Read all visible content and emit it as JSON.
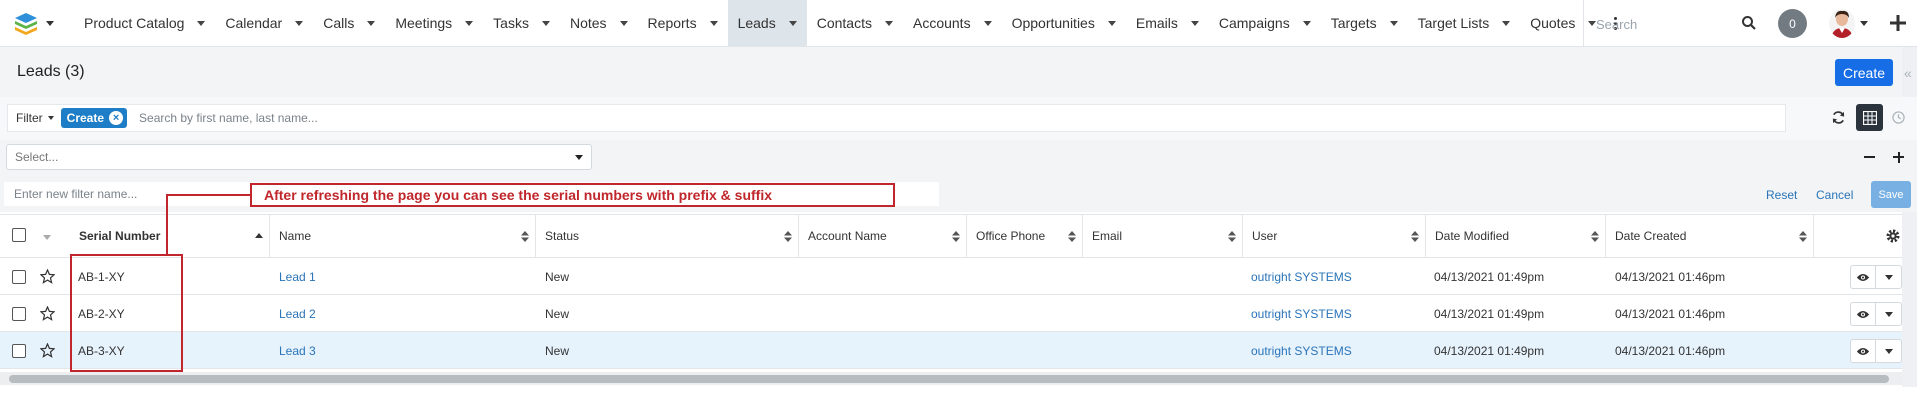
{
  "nav": {
    "items": [
      {
        "label": "Product Catalog",
        "active": false
      },
      {
        "label": "Calendar",
        "active": false
      },
      {
        "label": "Calls",
        "active": false
      },
      {
        "label": "Meetings",
        "active": false
      },
      {
        "label": "Tasks",
        "active": false
      },
      {
        "label": "Notes",
        "active": false
      },
      {
        "label": "Reports",
        "active": false
      },
      {
        "label": "Leads",
        "active": true
      },
      {
        "label": "Contacts",
        "active": false
      },
      {
        "label": "Accounts",
        "active": false
      },
      {
        "label": "Opportunities",
        "active": false
      },
      {
        "label": "Emails",
        "active": false
      },
      {
        "label": "Campaigns",
        "active": false
      },
      {
        "label": "Targets",
        "active": false
      },
      {
        "label": "Target Lists",
        "active": false
      },
      {
        "label": "Quotes",
        "active": false
      }
    ],
    "search_placeholder": "Search",
    "notification_count": "0"
  },
  "header": {
    "title": "Leads (3)",
    "create_label": "Create"
  },
  "filter": {
    "label": "Filter",
    "pill_label": "Create",
    "search_placeholder": "Search by first name, last name...",
    "select_placeholder": "Select...",
    "new_filter_placeholder": "Enter new filter name...",
    "reset_label": "Reset",
    "cancel_label": "Cancel",
    "save_label": "Save"
  },
  "annotation": {
    "text": "After refreshing the page you can see the serial numbers with prefix & suffix",
    "color": "#c0262b"
  },
  "table": {
    "columns": [
      "Serial Number",
      "Name",
      "Status",
      "Account Name",
      "Office Phone",
      "Email",
      "User",
      "Date Modified",
      "Date Created"
    ],
    "rows": [
      {
        "serial": "AB-1-XY",
        "name": "Lead 1",
        "status": "New",
        "account": "",
        "phone": "",
        "email": "",
        "user": "outright SYSTEMS",
        "modified": "04/13/2021 01:49pm",
        "created": "04/13/2021 01:46pm"
      },
      {
        "serial": "AB-2-XY",
        "name": "Lead 2",
        "status": "New",
        "account": "",
        "phone": "",
        "email": "",
        "user": "outright SYSTEMS",
        "modified": "04/13/2021 01:49pm",
        "created": "04/13/2021 01:46pm"
      },
      {
        "serial": "AB-3-XY",
        "name": "Lead 3",
        "status": "New",
        "account": "",
        "phone": "",
        "email": "",
        "user": "outright SYSTEMS",
        "modified": "04/13/2021 01:49pm",
        "created": "04/13/2021 01:46pm"
      }
    ]
  },
  "colors": {
    "accent": "#176de5",
    "link": "#2a74b8",
    "pill": "#1d7ec7",
    "active_nav": "#dde4ea",
    "highlight_row": "#e6f2fc"
  }
}
